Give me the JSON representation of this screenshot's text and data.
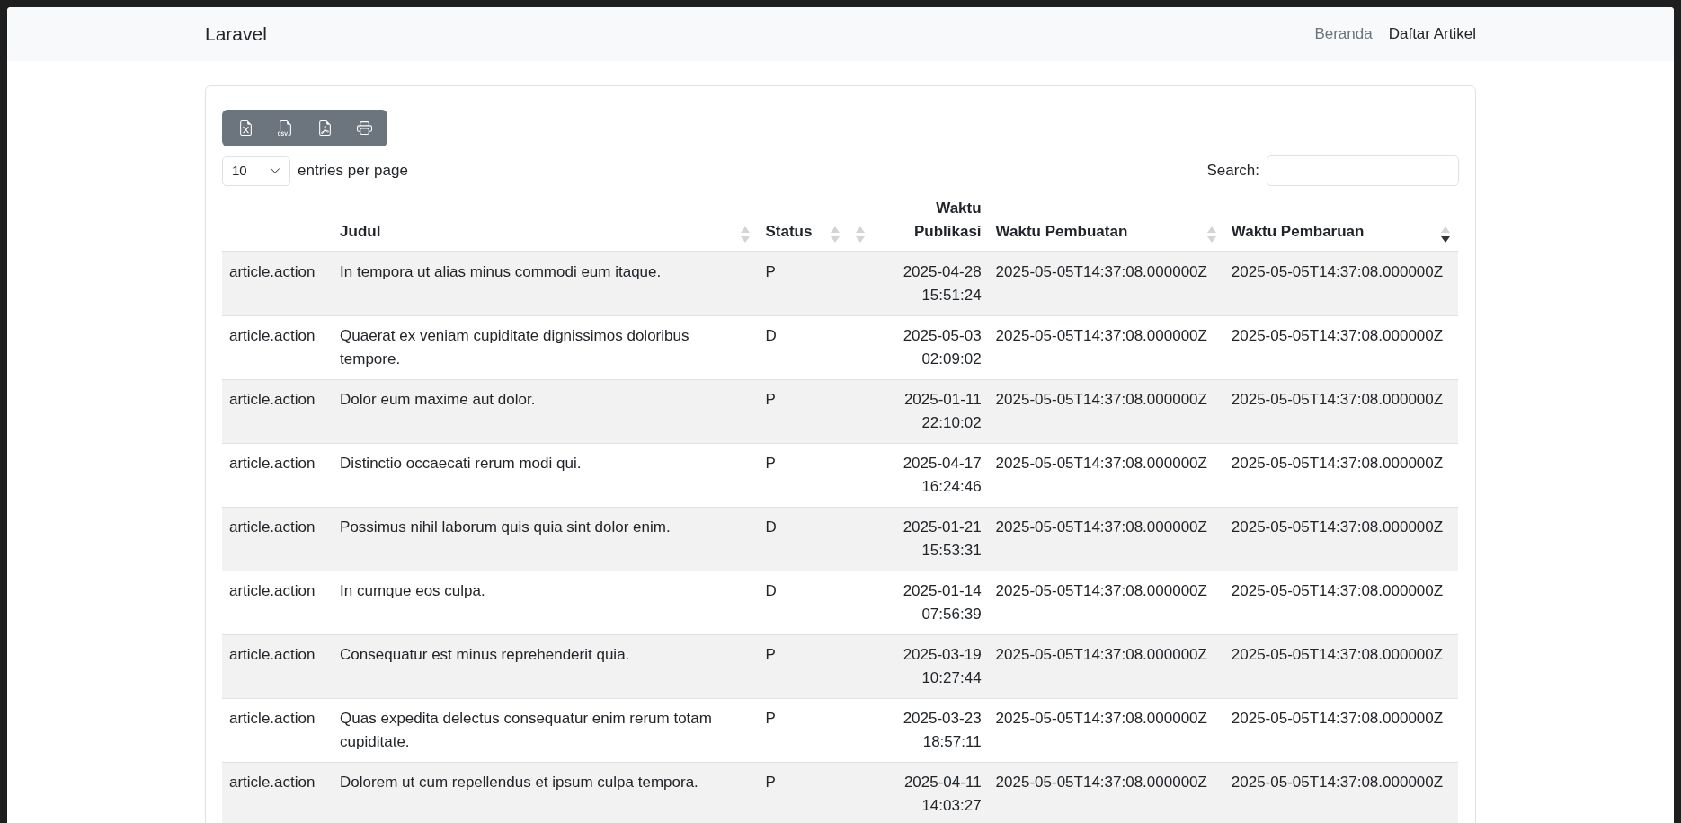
{
  "navbar": {
    "brand": "Laravel",
    "links": [
      {
        "label": "Beranda",
        "selected": false
      },
      {
        "label": "Daftar Artikel",
        "selected": true
      }
    ]
  },
  "export_buttons": [
    {
      "kind": "excel"
    },
    {
      "kind": "csv"
    },
    {
      "kind": "pdf"
    },
    {
      "kind": "print"
    }
  ],
  "page_length": {
    "value": "10",
    "label": "entries per page"
  },
  "search": {
    "label": "Search:"
  },
  "table": {
    "columns": [
      {
        "right_aligned": false
      },
      {
        "label": "Judul",
        "right_aligned": false,
        "sorted_descending": false
      },
      {
        "label": "Status",
        "right_aligned": false,
        "sorted_descending": false
      },
      {
        "label": "Waktu Publikasi",
        "right_aligned": true,
        "sorted_descending": false
      },
      {
        "label": "Waktu Pembuatan",
        "right_aligned": false,
        "sorted_descending": false
      },
      {
        "label": "Waktu Pembaruan",
        "right_aligned": false,
        "sorted_descending": true
      }
    ],
    "rows": [
      [
        "article.action",
        "In tempora ut alias minus commodi eum itaque.",
        "P",
        "2025-04-28 15:51:24",
        "2025-05-05T14:37:08.000000Z",
        "2025-05-05T14:37:08.000000Z"
      ],
      [
        "article.action",
        "Quaerat ex veniam cupiditate dignissimos doloribus tempore.",
        "D",
        "2025-05-03 02:09:02",
        "2025-05-05T14:37:08.000000Z",
        "2025-05-05T14:37:08.000000Z"
      ],
      [
        "article.action",
        "Dolor eum maxime aut dolor.",
        "P",
        "2025-01-11 22:10:02",
        "2025-05-05T14:37:08.000000Z",
        "2025-05-05T14:37:08.000000Z"
      ],
      [
        "article.action",
        "Distinctio occaecati rerum modi qui.",
        "P",
        "2025-04-17 16:24:46",
        "2025-05-05T14:37:08.000000Z",
        "2025-05-05T14:37:08.000000Z"
      ],
      [
        "article.action",
        "Possimus nihil laborum quis quia sint dolor enim.",
        "D",
        "2025-01-21 15:53:31",
        "2025-05-05T14:37:08.000000Z",
        "2025-05-05T14:37:08.000000Z"
      ],
      [
        "article.action",
        "In cumque eos culpa.",
        "D",
        "2025-01-14 07:56:39",
        "2025-05-05T14:37:08.000000Z",
        "2025-05-05T14:37:08.000000Z"
      ],
      [
        "article.action",
        "Consequatur est minus reprehenderit quia.",
        "P",
        "2025-03-19 10:27:44",
        "2025-05-05T14:37:08.000000Z",
        "2025-05-05T14:37:08.000000Z"
      ],
      [
        "article.action",
        "Quas expedita delectus consequatur enim rerum totam cupiditate.",
        "P",
        "2025-03-23 18:57:11",
        "2025-05-05T14:37:08.000000Z",
        "2025-05-05T14:37:08.000000Z"
      ],
      [
        "article.action",
        "Dolorem ut cum repellendus et ipsum culpa tempora.",
        "P",
        "2025-04-11 14:03:27",
        "2025-05-05T14:37:08.000000Z",
        "2025-05-05T14:37:08.000000Z"
      ]
    ]
  }
}
